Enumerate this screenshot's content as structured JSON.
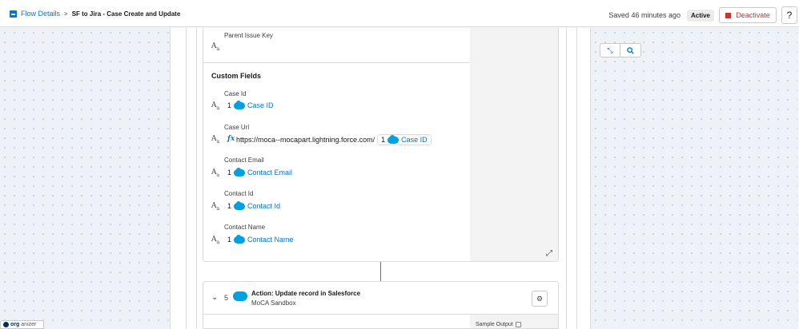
{
  "header": {
    "breadcrumb_link": "Flow Details",
    "breadcrumb_sep": ">",
    "flow_title": "SF to Jira - Case Create and Update",
    "saved_text": "Saved 46 minutes ago",
    "status_badge": "Active",
    "deactivate_label": "Deactivate",
    "help_label": "?"
  },
  "card": {
    "parent_issue_key_label": "Parent Issue Key",
    "custom_fields_title": "Custom Fields",
    "fields": [
      {
        "label": "Case Id",
        "num": "1",
        "ref": "Case ID"
      },
      {
        "label": "Case Url",
        "url": "https://moca--mocapart.lightning.force.com/",
        "num": "1",
        "ref": "Case ID"
      },
      {
        "label": "Contact Email",
        "num": "1",
        "ref": "Contact Email"
      },
      {
        "label": "Contact Id",
        "num": "1",
        "ref": "Contact Id"
      },
      {
        "label": "Contact Name",
        "num": "1",
        "ref": "Contact Name"
      }
    ],
    "text_type_icon": "text-type-icon",
    "formula_icon": "fx"
  },
  "action": {
    "step_number": "5",
    "title": "Action: Update record in Salesforce",
    "subtitle": "MoCA Sandbox",
    "sample_output": "Sample Output"
  },
  "organizer": {
    "prefix": "org",
    "suffix": "anizer"
  },
  "colors": {
    "brand": "#0176d3",
    "danger": "#c23934",
    "salesforce_cloud": "#00a1e0"
  }
}
